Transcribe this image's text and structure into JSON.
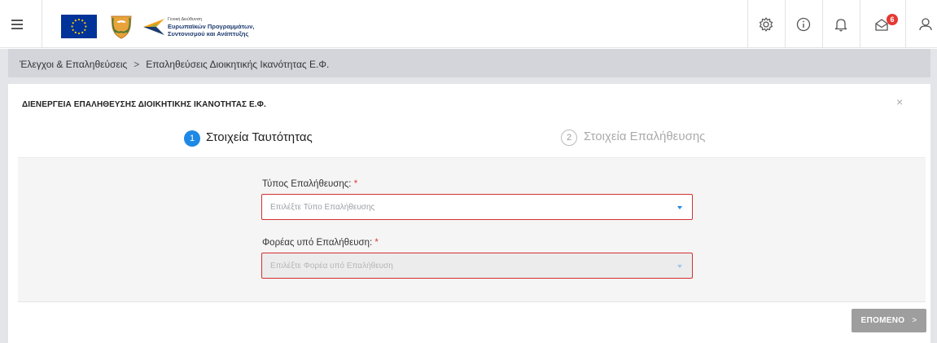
{
  "header": {
    "logo_text": {
      "line1": "Γενική Διεύθυνση",
      "line2": "Ευρωπαϊκών Προγραμμάτων,",
      "line3": "Συντονισμού και Ανάπτυξης"
    },
    "icons": [
      "menu-icon",
      "settings-icon",
      "info-icon",
      "bell-icon",
      "messages-icon",
      "user-icon"
    ],
    "messages_badge": "6"
  },
  "breadcrumb": {
    "items": [
      "Έλεγχοι & Επαληθεύσεις",
      "Επαληθεύσεις Διοικητικής Ικανότητας Ε.Φ."
    ],
    "separator": ">"
  },
  "panel": {
    "title": "ΔΙΕΝΕΡΓΕΙΑ ΕΠΑΛΗΘΕΥΣΗΣ ΔΙΟΙΚΗΤΙΚΗΣ ΙΚΑΝΟΤΗΤΑΣ Ε.Φ.",
    "close": "×"
  },
  "stepper": {
    "steps": [
      {
        "number": "1",
        "label": "Στοιχεία Ταυτότητας",
        "active": true
      },
      {
        "number": "2",
        "label": "Στοιχεία Επαλήθευσης",
        "active": false
      }
    ]
  },
  "form": {
    "verification_type": {
      "label": "Τύπος Επαλήθευσης:",
      "required": "*",
      "placeholder": "Επιλέξτε Τύπο Επαλήθευσης"
    },
    "entity": {
      "label": "Φορέας υπό Επαλήθευση:",
      "required": "*",
      "placeholder": "Επιλέξτε Φορέα υπό Επαλήθευση"
    }
  },
  "footer": {
    "next_label": "ΕΠΟΜΕΝΟ",
    "next_chevron": ">"
  },
  "colors": {
    "accent": "#1e88e5",
    "error_border": "#d32f2f",
    "badge": "#e53935",
    "disabled_button": "#9e9e9e"
  }
}
